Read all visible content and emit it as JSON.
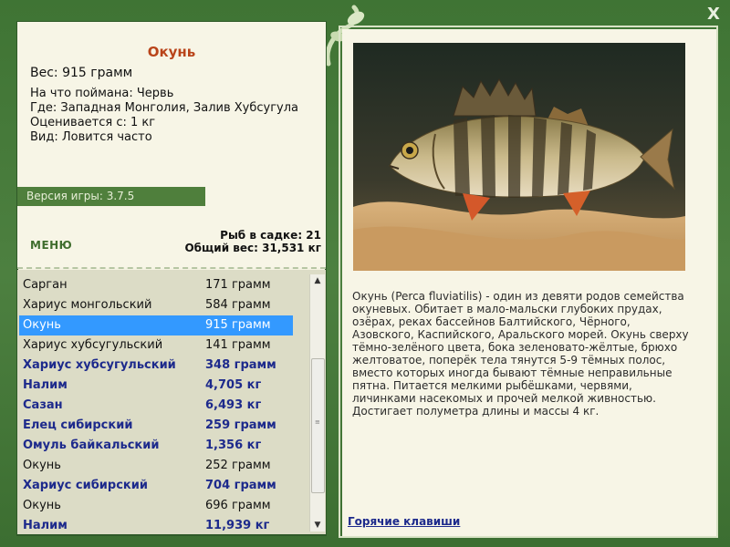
{
  "fish": {
    "title": "Окунь",
    "weight_line": "Вес: 915 грамм",
    "caught_with": "На что поймана: Червь",
    "location": "Где: Западная Монголия, Залив Хубсугула",
    "valued_from": "Оценивается с: 1 кг",
    "rarity": "Вид: Ловится часто",
    "description": "Окунь (Perca fluviatilis) - один из девяти родов семейства окуневых. Обитает в мало-мальски глубоких прудах, озёрах, реках бассейнов Балтийского, Чёрного, Азовского, Каспийского, Аральского морей. Окунь сверху тёмно-зелёного цвета, бока зеленовато-жёлтые, брюхо желтоватое, поперёк тела тянутся 5-9 тёмных полос, вместо которых иногда бывают тёмные неправильные пятна. Питается мелкими рыбёшками, червями, личинками насекомых и прочей мелкой живностью. Достигает полуметра длины и массы 4 кг."
  },
  "version": "Версия игры: 3.7.5",
  "menu_label": "МЕНЮ",
  "stats": {
    "fish_count": "Рыб в садке: 21",
    "total_weight": "Общий вес: 31,531 кг"
  },
  "catch_list": [
    {
      "name": "Сарган",
      "weight": "171 грамм",
      "bold": false,
      "selected": false
    },
    {
      "name": "Хариус монгольский",
      "weight": "584 грамм",
      "bold": false,
      "selected": false
    },
    {
      "name": "Окунь",
      "weight": "915 грамм",
      "bold": false,
      "selected": true
    },
    {
      "name": "Хариус хубсугульский",
      "weight": "141 грамм",
      "bold": false,
      "selected": false
    },
    {
      "name": "Хариус хубсугульский",
      "weight": "348 грамм",
      "bold": true,
      "selected": false
    },
    {
      "name": "Налим",
      "weight": "4,705 кг",
      "bold": true,
      "selected": false
    },
    {
      "name": "Сазан",
      "weight": "6,493 кг",
      "bold": true,
      "selected": false
    },
    {
      "name": "Елец сибирский",
      "weight": "259 грамм",
      "bold": true,
      "selected": false
    },
    {
      "name": "Омуль байкальский",
      "weight": "1,356 кг",
      "bold": true,
      "selected": false
    },
    {
      "name": "Окунь",
      "weight": "252 грамм",
      "bold": false,
      "selected": false
    },
    {
      "name": "Хариус сибирский",
      "weight": "704 грамм",
      "bold": true,
      "selected": false
    },
    {
      "name": "Окунь",
      "weight": "696 грамм",
      "bold": false,
      "selected": false
    },
    {
      "name": "Налим",
      "weight": "11,939 кг",
      "bold": true,
      "selected": false
    }
  ],
  "hotkeys_label": "Горячие клавиши",
  "close_label": "X",
  "colors": {
    "frame_green": "#4a7a3a",
    "title_orange": "#b9441a",
    "selection_blue": "#3399ff",
    "bold_blue": "#1d2a8c"
  }
}
